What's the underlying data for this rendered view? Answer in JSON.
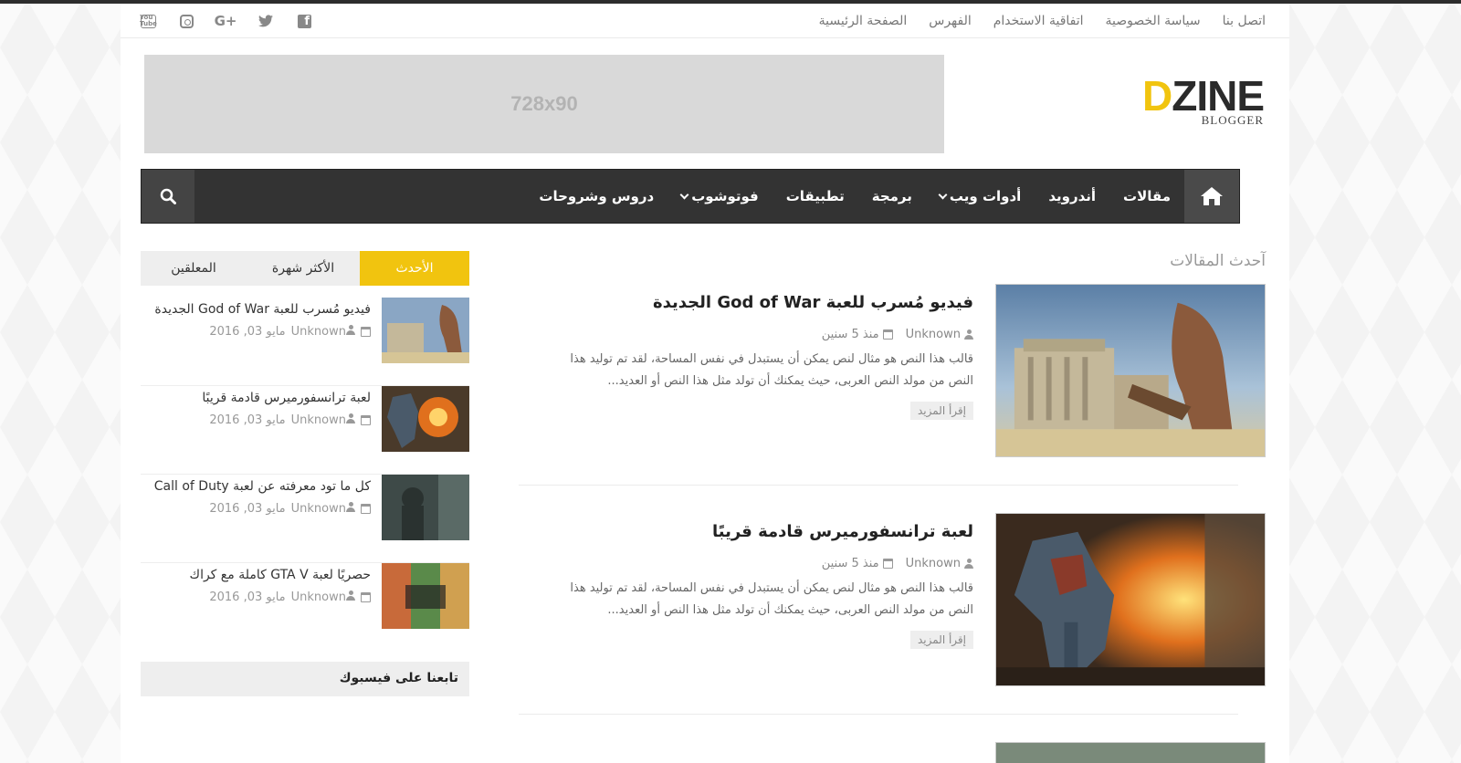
{
  "topbar": {
    "links": [
      "الصفحة الرئيسية",
      "الفهرس",
      "اتفاقية الاستخدام",
      "سياسة الخصوصية",
      "اتصل بنا"
    ],
    "social": [
      "facebook-icon",
      "twitter-icon",
      "google-plus-icon",
      "instagram-icon",
      "youtube-icon"
    ],
    "yt_text": "You Tube",
    "gplus_text": "G+",
    "fb_text": "f"
  },
  "banner": {
    "label": "728x90"
  },
  "logo": {
    "first": "D",
    "rest": "ZINE",
    "sub": "BLOGGER"
  },
  "nav": {
    "items": [
      {
        "label": "مقالات"
      },
      {
        "label": "أندرويد"
      },
      {
        "label": "أدوات ويب"
      },
      {
        "label": "برمجة"
      },
      {
        "label": "تطبيقات"
      },
      {
        "label": "فوتوشوب"
      },
      {
        "label": "دروس وشروحات"
      }
    ]
  },
  "main": {
    "section_title": "آحدث المقالات",
    "posts": [
      {
        "title": "فيديو مُسرب للعبة God of War الجديدة",
        "author": "Unknown",
        "date": "منذ 5 سنين",
        "excerpt": "قالب هذا النص هو مثال لنص يمكن أن يستبدل في نفس المساحة، لقد تم توليد هذا النص من مولد النص العربى، حيث يمكنك أن تولد مثل هذا النص أو العديد...",
        "readmore": "إقرأ المزيد"
      },
      {
        "title": "لعبة ترانسفورميرس قادمة قريبًا",
        "author": "Unknown",
        "date": "منذ 5 سنين",
        "excerpt": "قالب هذا النص هو مثال لنص يمكن أن يستبدل في نفس المساحة، لقد تم توليد هذا النص من مولد النص العربى، حيث يمكنك أن تولد مثل هذا النص أو العديد...",
        "readmore": "إقرأ المزيد"
      }
    ]
  },
  "sidebar": {
    "tabs": [
      "الأحدث",
      "الأكثر شهرة",
      "المعلقين"
    ],
    "items": [
      {
        "title": "فيديو مُسرب للعبة God of War الجديدة",
        "author": "Unknown",
        "date": "مايو 03, 2016"
      },
      {
        "title": "لعبة ترانسفورميرس قادمة قريبًا",
        "author": "Unknown",
        "date": "مايو 03, 2016"
      },
      {
        "title": "كل ما تود معرفته عن لعبة Call of Duty",
        "author": "Unknown",
        "date": "مايو 03, 2016"
      },
      {
        "title": "حصريًا لعبة GTA V كاملة مع كراك",
        "author": "Unknown",
        "date": "مايو 03, 2016"
      }
    ],
    "facebook_title": "تابعنا على فيسبوك"
  },
  "colors": {
    "accent": "#f1c40f",
    "nav_bg": "#333333",
    "text": "#222222"
  }
}
